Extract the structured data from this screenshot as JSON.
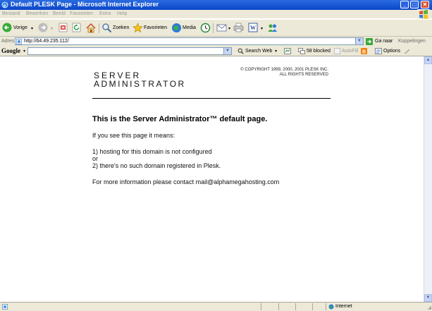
{
  "window": {
    "title": "Default PLESK Page - Microsoft Internet Explorer"
  },
  "menu": [
    "Bestand",
    "Bewerken",
    "Beeld",
    "Favorieten",
    "Extra",
    "Help"
  ],
  "toolbar": {
    "back": "Vorige",
    "search": "Zoeken",
    "favorites": "Favorieten",
    "media": "Media"
  },
  "address": {
    "label": "Adres",
    "url": "http://64.49.235.112/",
    "go": "Ga naar",
    "links": "Koppelingen"
  },
  "google": {
    "logo": "Google",
    "search_web": "Search Web",
    "blocked": "58 blocked",
    "autofill": "AutoFill",
    "options": "Options"
  },
  "page": {
    "logo_line1": "SERVER",
    "logo_line2": "ADMINISTRATOR",
    "copyright_line1": "© COPYRIGHT 1999, 2000, 2001 PLESK INC.",
    "copyright_line2": "ALL RIGHTS RESERVED",
    "heading": "This is the Server Administrator™ default page.",
    "intro": "If you see this page it means:",
    "reason1": "1) hosting for this domain is not configured",
    "or": "or",
    "reason2": "2) there's no such domain registered in Plesk.",
    "contact": "For more information please contact mail@alphamegahosting.com"
  },
  "status": {
    "zone": "Internet"
  },
  "colors": {
    "titlebar": "#0a46c8",
    "chrome": "#ece9d8",
    "close": "#d9502c"
  }
}
